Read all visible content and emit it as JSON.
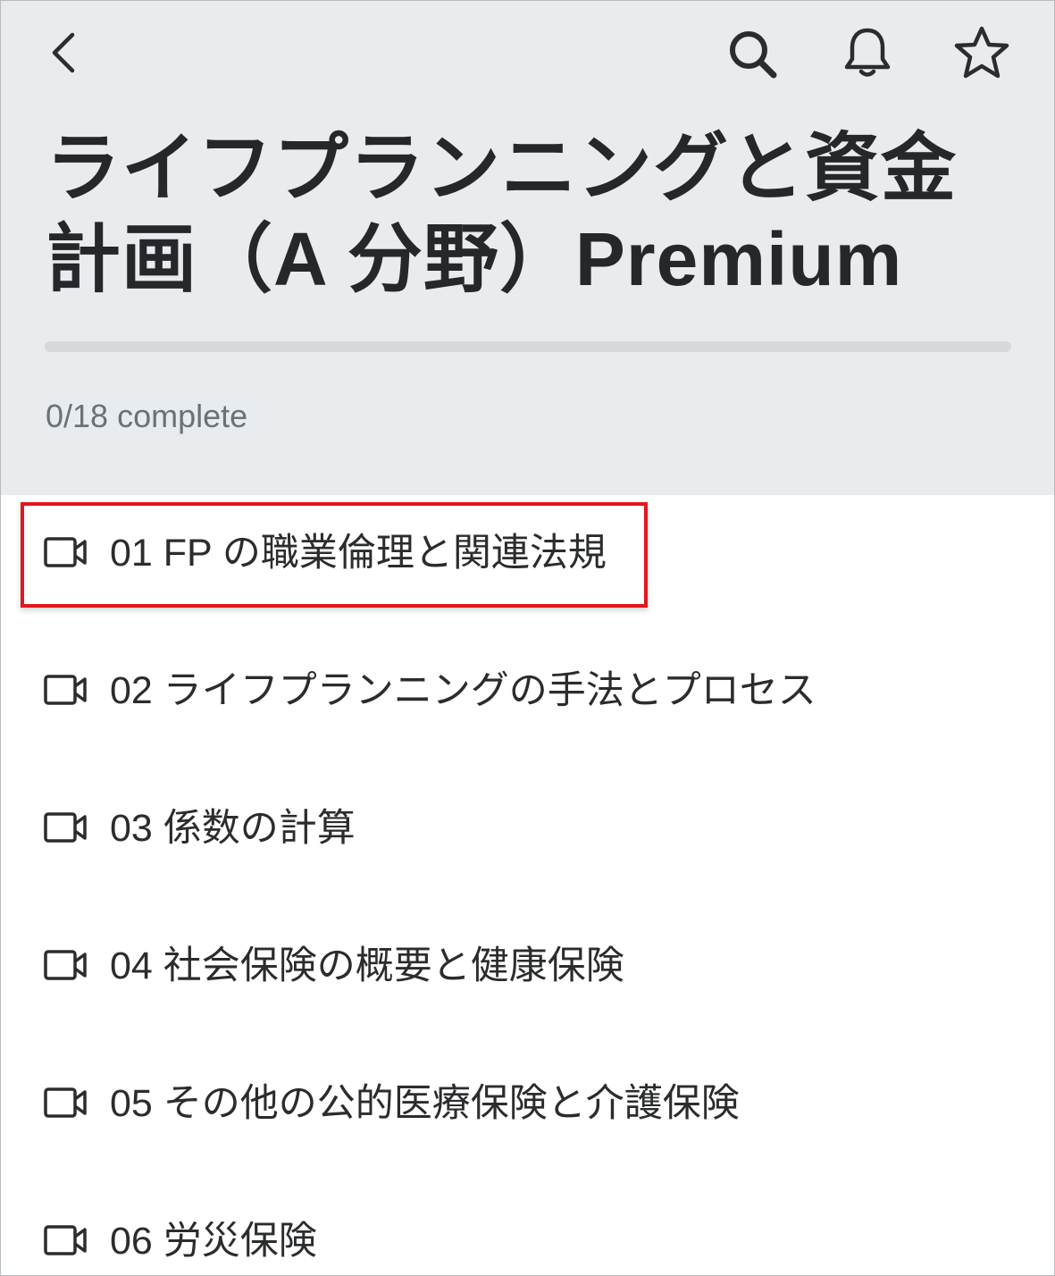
{
  "header": {
    "title": "ライフプランニングと資金計画（A 分野）Premium",
    "progress_text": "0/18 complete",
    "progress_fraction": 0,
    "icons": {
      "back": "back-chevron-icon",
      "search": "search-icon",
      "bell": "bell-icon",
      "star": "star-icon"
    }
  },
  "lessons": [
    {
      "label": "01 FP の職業倫理と関連法規",
      "icon": "video-camera-icon",
      "highlighted": true
    },
    {
      "label": "02 ライフプランニングの手法とプロセス",
      "icon": "video-camera-icon",
      "highlighted": false
    },
    {
      "label": "03 係数の計算",
      "icon": "video-camera-icon",
      "highlighted": false
    },
    {
      "label": "04 社会保険の概要と健康保険",
      "icon": "video-camera-icon",
      "highlighted": false
    },
    {
      "label": "05 その他の公的医療保険と介護保険",
      "icon": "video-camera-icon",
      "highlighted": false
    },
    {
      "label": "06 労災保険",
      "icon": "video-camera-icon",
      "highlighted": false
    }
  ],
  "colors": {
    "header_bg": "#e9ecee",
    "highlight": "#e3161d",
    "progress_track": "#d6d9dc"
  }
}
